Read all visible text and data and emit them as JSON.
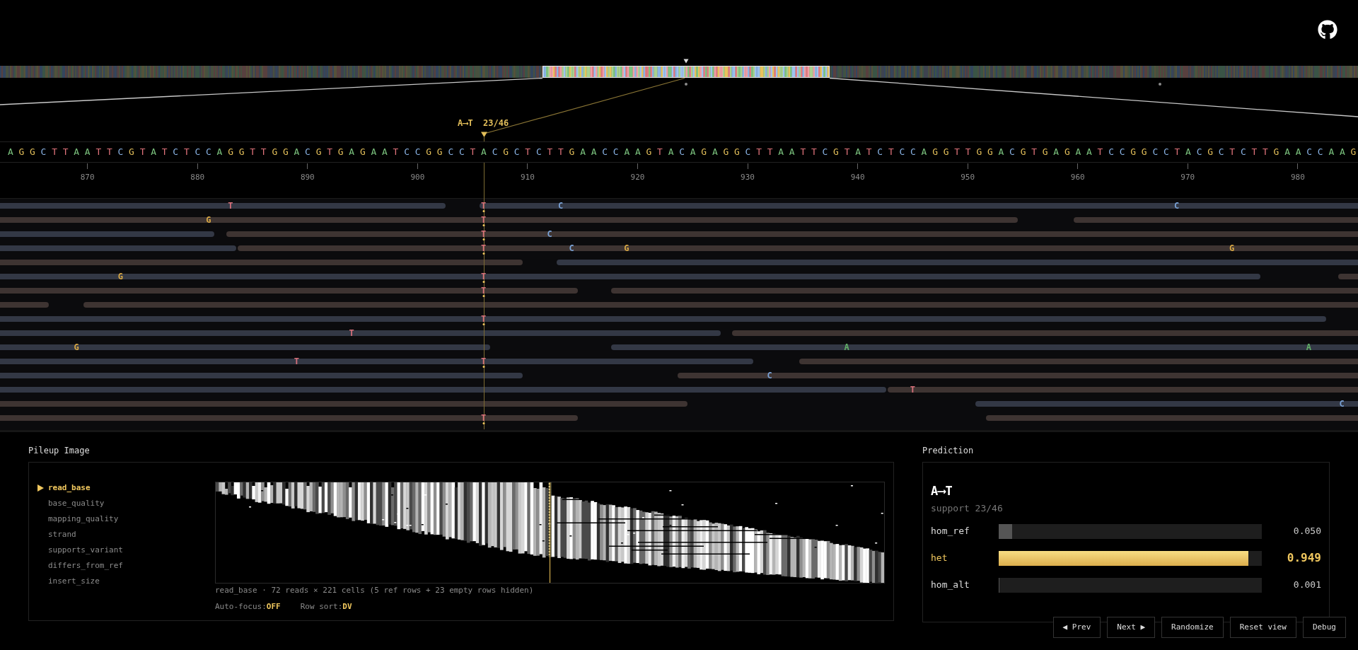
{
  "variant_marker": {
    "label": "A⟶T  23/46"
  },
  "reference": {
    "sequence": "A G G C T T A A T T C G T A T C T C C A G G T T G G A C G T G A G A A T C C G G C C T A C G C T C T T G A A C C A A G T A C A G A G G C T T A A T T C G T A T C T C C A G G T T G G A C G T G A G A A T C C G G C C T A C G C T C T T G A A C C A A G",
    "ruler_ticks": [
      "870",
      "880",
      "890",
      "900",
      "910",
      "920",
      "930",
      "940",
      "950",
      "960",
      "970",
      "980"
    ]
  },
  "reads": {
    "rows": [
      {
        "reads": [
          {
            "reverse": false,
            "mismatches": [
              {
                "base": "T",
                "supports_variant": false
              }
            ]
          },
          {
            "reverse": false,
            "mismatches": [
              {
                "base": "T",
                "supports_variant": true
              },
              {
                "base": "C",
                "supports_variant": false
              },
              {
                "base": "C",
                "supports_variant": false
              }
            ]
          }
        ]
      },
      {
        "reads": [
          {
            "reverse": true,
            "mismatches": [
              {
                "base": "G",
                "supports_variant": false
              },
              {
                "base": "T",
                "supports_variant": true
              }
            ]
          },
          {
            "reverse": true
          }
        ]
      },
      {
        "reads": [
          {
            "reverse": false
          },
          {
            "reverse": true,
            "mismatches": [
              {
                "base": "T",
                "supports_variant": true
              },
              {
                "base": "C",
                "supports_variant": false
              }
            ]
          }
        ]
      },
      {
        "reads": [
          {
            "reverse": false
          },
          {
            "reverse": true,
            "mismatches": [
              {
                "base": "T",
                "supports_variant": true
              },
              {
                "base": "C",
                "supports_variant": false
              },
              {
                "base": "G",
                "supports_variant": false
              },
              {
                "base": "G",
                "supports_variant": false
              }
            ]
          }
        ]
      },
      {
        "reads": [
          {
            "reverse": true
          },
          {
            "reverse": false
          }
        ]
      },
      {
        "reads": [
          {
            "reverse": false,
            "mismatches": [
              {
                "base": "G",
                "supports_variant": false
              },
              {
                "base": "T",
                "supports_variant": true
              }
            ]
          },
          {
            "reverse": true
          }
        ]
      },
      {
        "reads": [
          {
            "reverse": true,
            "mismatches": [
              {
                "base": "T",
                "supports_variant": true
              }
            ]
          },
          {
            "reverse": true
          }
        ]
      },
      {
        "reads": [
          {
            "reverse": true
          },
          {
            "reverse": true
          }
        ]
      },
      {
        "reads": [
          {
            "reverse": false,
            "mismatches": [
              {
                "base": "T",
                "supports_variant": true
              }
            ]
          }
        ]
      },
      {
        "reads": [
          {
            "reverse": false,
            "mismatches": [
              {
                "base": "T",
                "supports_variant": false
              }
            ]
          },
          {
            "reverse": true
          }
        ]
      },
      {
        "reads": [
          {
            "reverse": false,
            "mismatches": [
              {
                "base": "G",
                "supports_variant": false
              }
            ]
          },
          {
            "reverse": false,
            "mismatches": [
              {
                "base": "A",
                "supports_variant": false
              },
              {
                "base": "A",
                "supports_variant": false
              }
            ]
          }
        ]
      },
      {
        "reads": [
          {
            "reverse": false,
            "mismatches": [
              {
                "base": "T",
                "supports_variant": false
              },
              {
                "base": "T",
                "supports_variant": true
              }
            ]
          },
          {
            "reverse": true
          }
        ]
      },
      {
        "reads": [
          {
            "reverse": false
          },
          {
            "reverse": true,
            "mismatches": [
              {
                "base": "C",
                "supports_variant": false
              }
            ]
          }
        ]
      },
      {
        "reads": [
          {
            "reverse": false
          },
          {
            "reverse": true,
            "mismatches": [
              {
                "base": "T",
                "supports_variant": false
              }
            ]
          }
        ]
      },
      {
        "reads": [
          {
            "reverse": true
          },
          {
            "reverse": false,
            "mismatches": [
              {
                "base": "C",
                "supports_variant": false
              }
            ]
          }
        ]
      },
      {
        "reads": [
          {
            "reverse": true,
            "mismatches": [
              {
                "base": "T",
                "supports_variant": true
              }
            ]
          },
          {
            "reverse": true
          }
        ]
      }
    ]
  },
  "pileup_image": {
    "title": "Pileup Image",
    "channels": [
      {
        "label": "read_base",
        "selected": true
      },
      {
        "label": "base_quality",
        "selected": false
      },
      {
        "label": "mapping_quality",
        "selected": false
      },
      {
        "label": "strand",
        "selected": false
      },
      {
        "label": "supports_variant",
        "selected": false
      },
      {
        "label": "differs_from_ref",
        "selected": false
      },
      {
        "label": "insert_size",
        "selected": false
      }
    ],
    "caption": "read_base · 72 reads × 221 cells (5 ref rows + 23 empty rows hidden)",
    "toggles": [
      {
        "label": "Auto-focus:",
        "value": "OFF"
      },
      {
        "label": "Row sort:",
        "value": "DV"
      }
    ]
  },
  "prediction": {
    "title": "Prediction",
    "variant": "A⟶T",
    "support": "support 23/46",
    "classes": [
      {
        "label": "hom_ref",
        "level": 0.05,
        "reading": "0.050",
        "highlighted": false
      },
      {
        "label": "het",
        "level": 0.949,
        "reading": "0.949",
        "highlighted": true
      },
      {
        "label": "hom_alt",
        "level": 0.001,
        "reading": "0.001",
        "highlighted": false
      }
    ]
  },
  "buttons": [
    "◀ Prev",
    "Next ▶",
    "Randomize",
    "Reset view",
    "Debug"
  ]
}
